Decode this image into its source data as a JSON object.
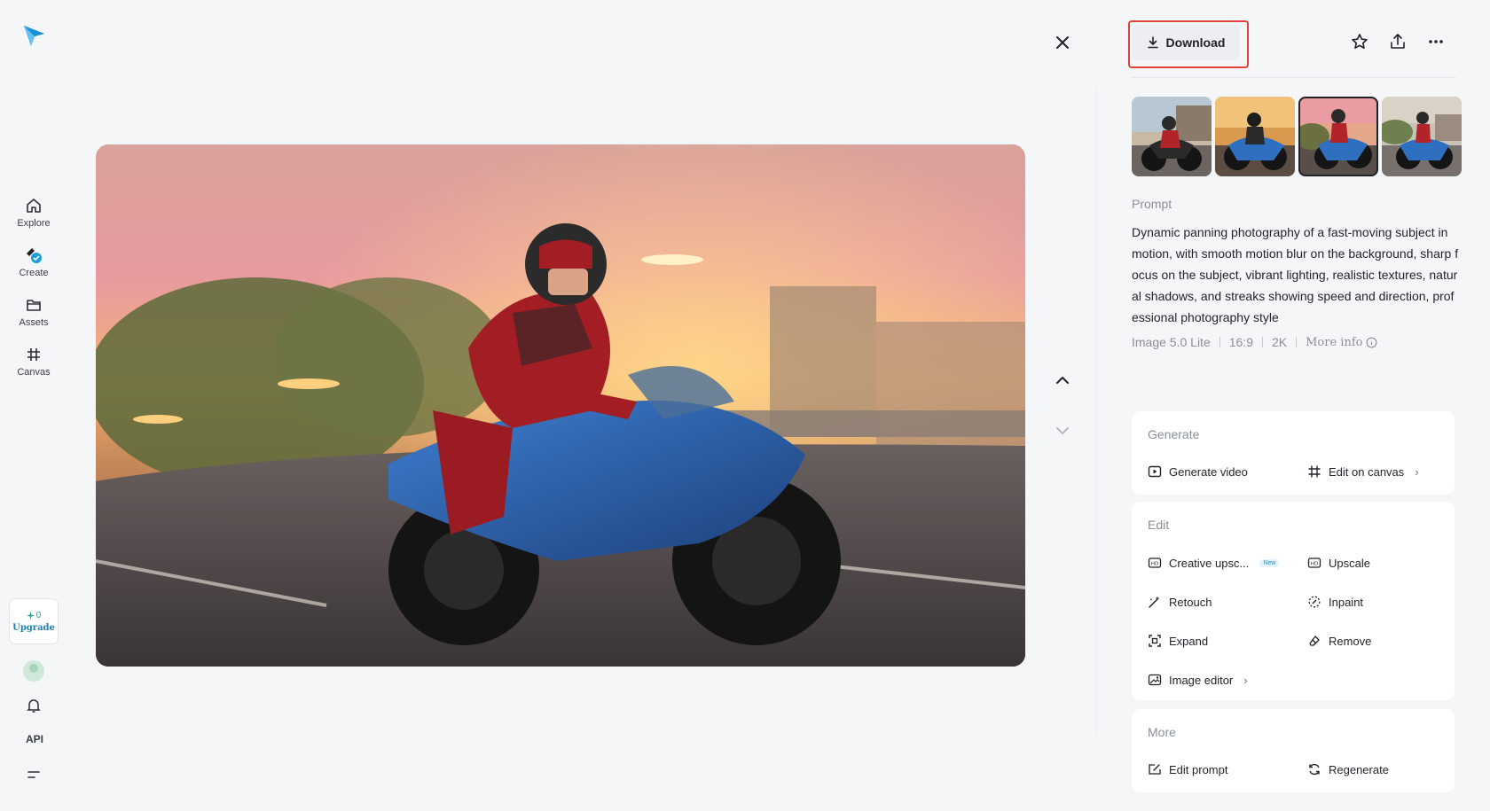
{
  "sidebar": {
    "items": [
      {
        "label": "Explore",
        "icon": "home-icon"
      },
      {
        "label": "Create",
        "icon": "create-icon"
      },
      {
        "label": "Assets",
        "icon": "folder-icon"
      },
      {
        "label": "Canvas",
        "icon": "canvas-icon"
      }
    ],
    "credits": {
      "count": "0",
      "upgrade_label": "Upgrade"
    },
    "api_label": "API"
  },
  "toolbar": {
    "download_label": "Download"
  },
  "prompt": {
    "label": "Prompt",
    "text": "Dynamic panning photography of a fast-moving subject in motion, with smooth motion blur on the background, sharp focus on the subject, vibrant lighting, realistic textures, natural shadows, and streaks showing speed and direction, professional photography style"
  },
  "meta": {
    "model": "Image 5.0 Lite",
    "ratio": "16:9",
    "resolution": "2K",
    "more_info": "More info"
  },
  "generate": {
    "title": "Generate",
    "generate_video": "Generate video",
    "edit_on_canvas": "Edit on canvas"
  },
  "edit": {
    "title": "Edit",
    "creative_upscale": "Creative upsc...",
    "new_badge": "New",
    "upscale": "Upscale",
    "retouch": "Retouch",
    "inpaint": "Inpaint",
    "expand": "Expand",
    "remove": "Remove",
    "image_editor": "Image editor"
  },
  "more": {
    "title": "More",
    "edit_prompt": "Edit prompt",
    "regenerate": "Regenerate"
  },
  "colors": {
    "accent_red": "#e2403a",
    "logo_blue": "#2ba6e8",
    "badge_teal": "#2a9d8f"
  }
}
